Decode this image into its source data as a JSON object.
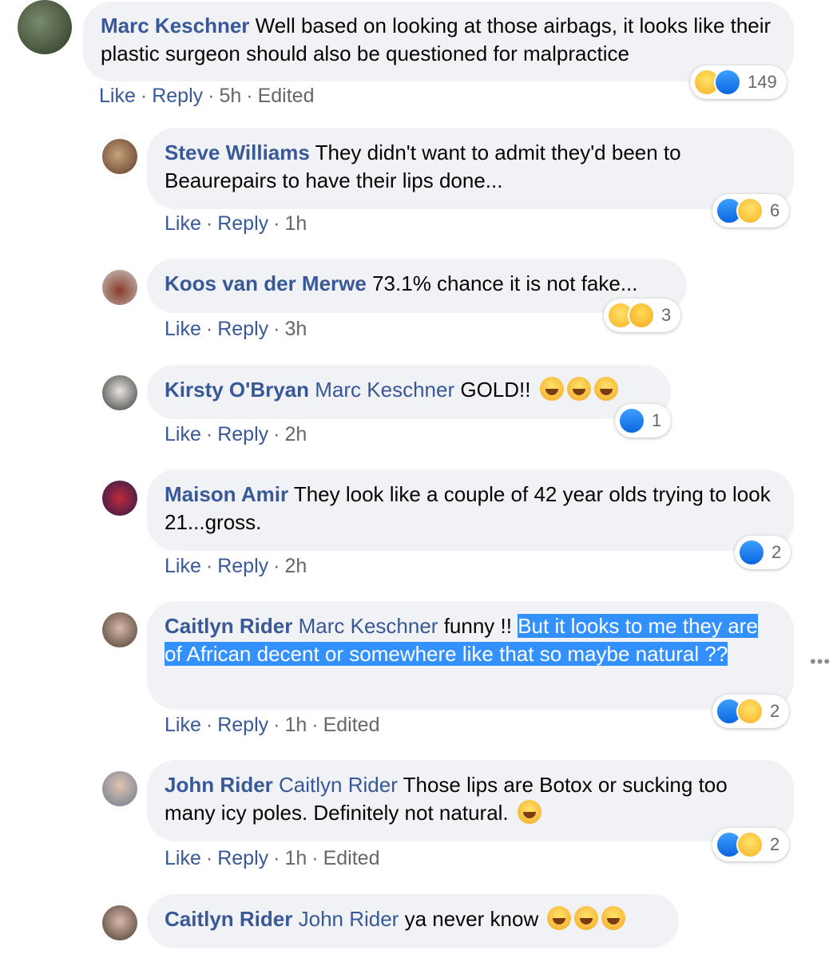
{
  "ui": {
    "like": "Like",
    "reply": "Reply",
    "edited": "Edited",
    "sep": "·",
    "more": "•••"
  },
  "comments": [
    {
      "author": "Marc Keschner",
      "text": "Well based on looking at those airbags, it looks like their plastic surgeon should also be questioned for malpractice",
      "time": "5h",
      "edited": true,
      "reactions": [
        "haha",
        "like"
      ],
      "count": "149"
    },
    {
      "author": "Steve Williams",
      "text": "They didn't want to admit they'd been to Beaurepairs to have their lips done...",
      "time": "1h",
      "reactions": [
        "like",
        "haha"
      ],
      "count": "6"
    },
    {
      "author": "Koos van der Merwe",
      "text": "73.1% chance it is not fake...",
      "time": "3h",
      "reactions": [
        "haha",
        "care"
      ],
      "count": "3"
    },
    {
      "author": "Kirsty O'Bryan",
      "mention": "Marc Keschner",
      "text": "GOLD!!",
      "time": "2h",
      "reactions": [
        "like"
      ],
      "count": "1"
    },
    {
      "author": "Maison Amir",
      "text": "They look like a couple of 42 year olds trying to look 21...gross.",
      "time": "2h",
      "reactions": [
        "like"
      ],
      "count": "2"
    },
    {
      "author": "Caitlyn Rider",
      "mention": "Marc Keschner",
      "text": "funny !!",
      "highlighted": "But it looks to me they are of African decent or somewhere like that so maybe natural ??",
      "time": "1h",
      "edited": true,
      "reactions": [
        "like",
        "haha"
      ],
      "count": "2"
    },
    {
      "author": "John Rider",
      "mention": "Caitlyn Rider",
      "text": "Those lips are Botox or sucking too many icy poles. Definitely not natural.",
      "time": "1h",
      "edited": true,
      "reactions": [
        "like",
        "haha"
      ],
      "count": "2"
    },
    {
      "author": "Caitlyn Rider",
      "mention": "John Rider",
      "text": "ya never know",
      "time": ""
    }
  ]
}
